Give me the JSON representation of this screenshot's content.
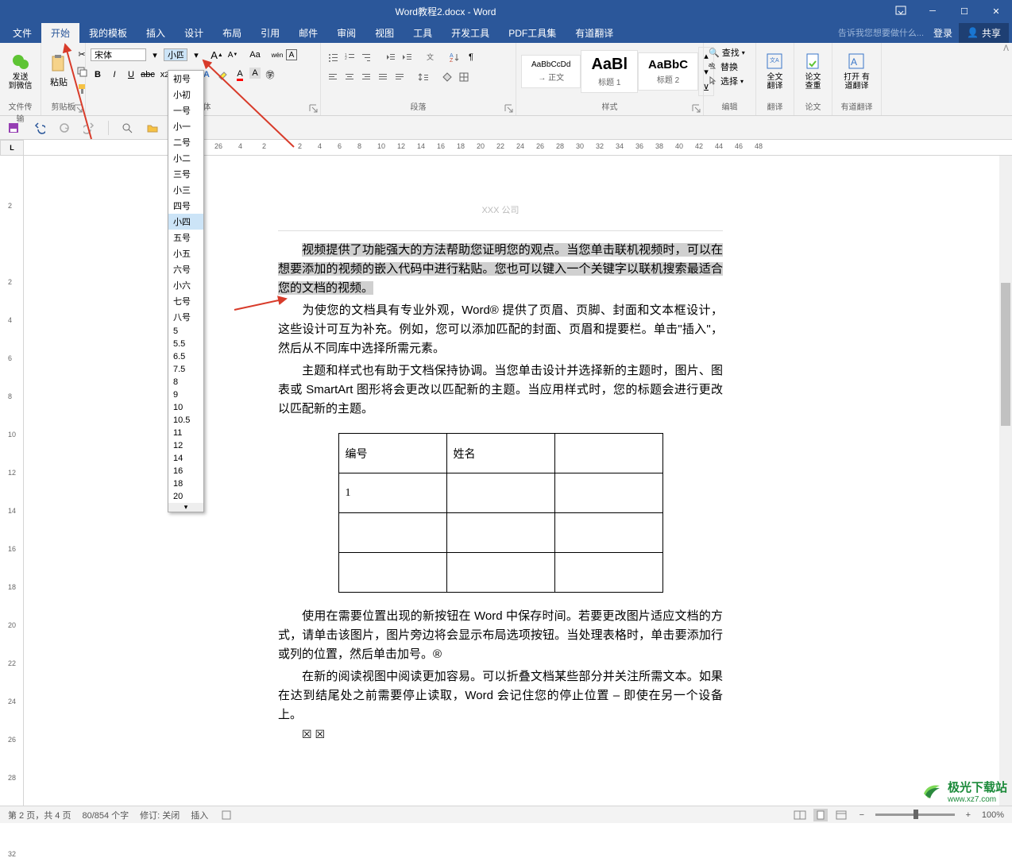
{
  "title": "Word教程2.docx - Word",
  "window": {
    "login": "登录",
    "share": "共享"
  },
  "menu": {
    "file": "文件",
    "home": "开始",
    "templates": "我的模板",
    "insert": "插入",
    "design": "设计",
    "layout": "布局",
    "references": "引用",
    "mail": "邮件",
    "review": "审阅",
    "view": "视图",
    "tools": "工具",
    "dev": "开发工具",
    "pdf": "PDF工具集",
    "youdao": "有道翻译",
    "tellme": "告诉我您想要做什么..."
  },
  "ribbon": {
    "sendwx": "发送\n到微信",
    "filetransfer": "文件传输",
    "paste": "粘贴",
    "clipboard": "剪贴板",
    "font_name": "宋体",
    "font_size": "小四",
    "font_label": "字体",
    "para_label": "段落",
    "styles": [
      {
        "preview": "AaBbCcDd",
        "name": "→ 正文"
      },
      {
        "preview": "AaBl",
        "name": "标题 1"
      },
      {
        "preview": "AaBbC",
        "name": "标题 2"
      }
    ],
    "styles_label": "样式",
    "find": "查找",
    "replace": "替换",
    "select": "选择",
    "edit_label": "编辑",
    "fulltrans": "全文\n翻译",
    "fulltrans_label": "翻译",
    "thesis": "论文\n查重",
    "thesis_label": "论文",
    "open_youdao": "打开\n有道翻译",
    "youdao_label": "有道翻译"
  },
  "sizes": [
    "初号",
    "小初",
    "一号",
    "小一",
    "二号",
    "小二",
    "三号",
    "小三",
    "四号",
    "小四",
    "五号",
    "小五",
    "六号",
    "小六",
    "七号",
    "八号",
    "5",
    "5.5",
    "6.5",
    "7.5",
    "8",
    "9",
    "10",
    "10.5",
    "11",
    "12",
    "14",
    "16",
    "18",
    "20"
  ],
  "ruler_h": [
    "26",
    "4",
    "2",
    "2",
    "4",
    "6",
    "8",
    "10",
    "12",
    "14",
    "16",
    "18",
    "20",
    "22",
    "24",
    "26",
    "28",
    "30",
    "32",
    "34",
    "36",
    "38",
    "40",
    "42",
    "44",
    "46",
    "48"
  ],
  "ruler_v": [
    "",
    "2",
    "",
    "2",
    "4",
    "6",
    "8",
    "10",
    "12",
    "14",
    "16",
    "18",
    "20",
    "22",
    "24",
    "26",
    "28",
    "30",
    "32"
  ],
  "doc": {
    "header": "XXX 公司",
    "p1a": "视频提供了功能强大的方法帮助您证明您的观点。当您单击联机视频时，可以在想要添加的视频的嵌入代码中进行粘贴。您也可以键入一个关键字以联机搜索最适合您的文档的视频。",
    "p2": "为使您的文档具有专业外观，Word® 提供了页眉、页脚、封面和文本框设计，这些设计可互为补充。例如，您可以添加匹配的封面、页眉和提要栏。单击\"插入\"，然后从不同库中选择所需元素。",
    "p3": "主题和样式也有助于文档保持协调。当您单击设计并选择新的主题时，图片、图表或 SmartArt 图形将会更改以匹配新的主题。当应用样式时，您的标题会进行更改以匹配新的主题。",
    "table": {
      "h1": "编号",
      "h2": "姓名",
      "r1": "1"
    },
    "p4": "使用在需要位置出现的新按钮在 Word 中保存时间。若要更改图片适应文档的方式，请单击该图片，图片旁边将会显示布局选项按钮。当处理表格时，单击要添加行或列的位置，然后单击加号。®",
    "p5": "在新的阅读视图中阅读更加容易。可以折叠文档某些部分并关注所需文本。如果在达到结尾处之前需要停止读取，Word 会记住您的停止位置 – 即使在另一个设备上。"
  },
  "status": {
    "page": "第 2 页，共 4 页",
    "words": "80/854 个字",
    "track": "修订: 关闭",
    "insert": "插入",
    "zoom": "100%"
  },
  "watermark": {
    "name": "极光下载站",
    "url": "www.xz7.com"
  }
}
